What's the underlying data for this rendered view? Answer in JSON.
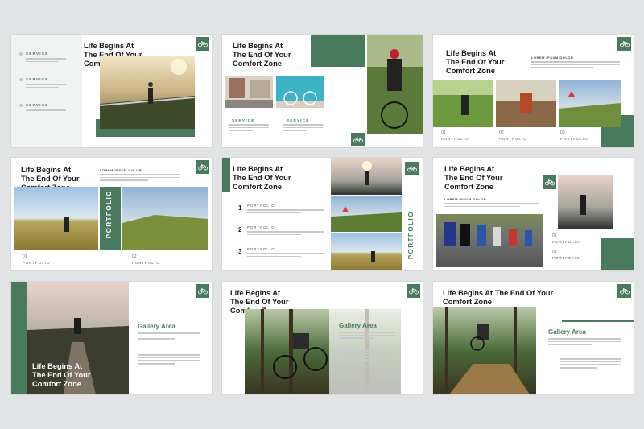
{
  "slogan": "Life Begins At\nThe End Of Your\nComfort Zone",
  "slogan_one_line": "Life Begins At The End Of Your\nComfort Zone",
  "service": "SERVICE",
  "portfolio": "PORTFOLIO",
  "lorem_heading": "LOREM IPSUM DOLOR",
  "gallery": "Gallery Area",
  "numbers": {
    "n01": "01",
    "n02": "02",
    "n03": "03",
    "n1": "1",
    "n2": "2",
    "n3": "3"
  },
  "icon": "bicycle-icon",
  "colors": {
    "accent": "#4a7a5e",
    "background": "#e2e3e4",
    "slide": "#ffffff"
  }
}
